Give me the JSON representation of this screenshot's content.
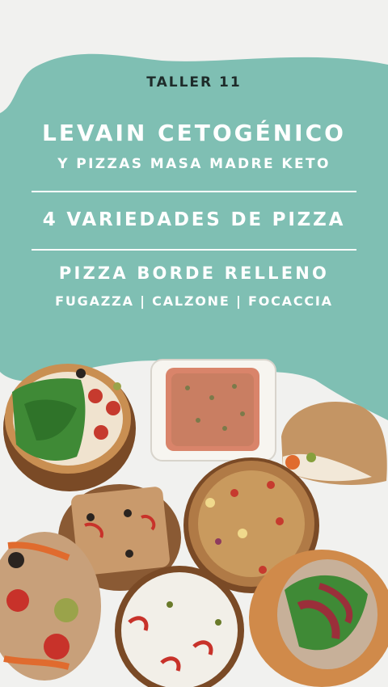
{
  "header": {
    "workshop": "TALLER 11",
    "title_main": "LEVAIN CETOGÉNICO",
    "title_sub": "Y PIZZAS MASA MADRE KETO",
    "varieties": "4 VARIEDADES DE PIZZA",
    "stuffed_crust": "PIZZA BORDE RELLENO",
    "styles": "FUGAZZA | CALZONE | FOCACCIA"
  },
  "colors": {
    "background": "#f1f1ef",
    "teal": "#7fbfb3",
    "text_dark": "#1e2b2a",
    "text_light": "#ffffff"
  },
  "images": [
    "pizza-arugula-pepperoni",
    "square-onion-pizza-glass-dish",
    "calzone",
    "rectangular-focaccia-tomato-olive",
    "fugazza-onion-pizza",
    "roasted-pepper-pizza",
    "pizza-white-cheese-red-pepper",
    "pizza-ham-arugula-board"
  ]
}
